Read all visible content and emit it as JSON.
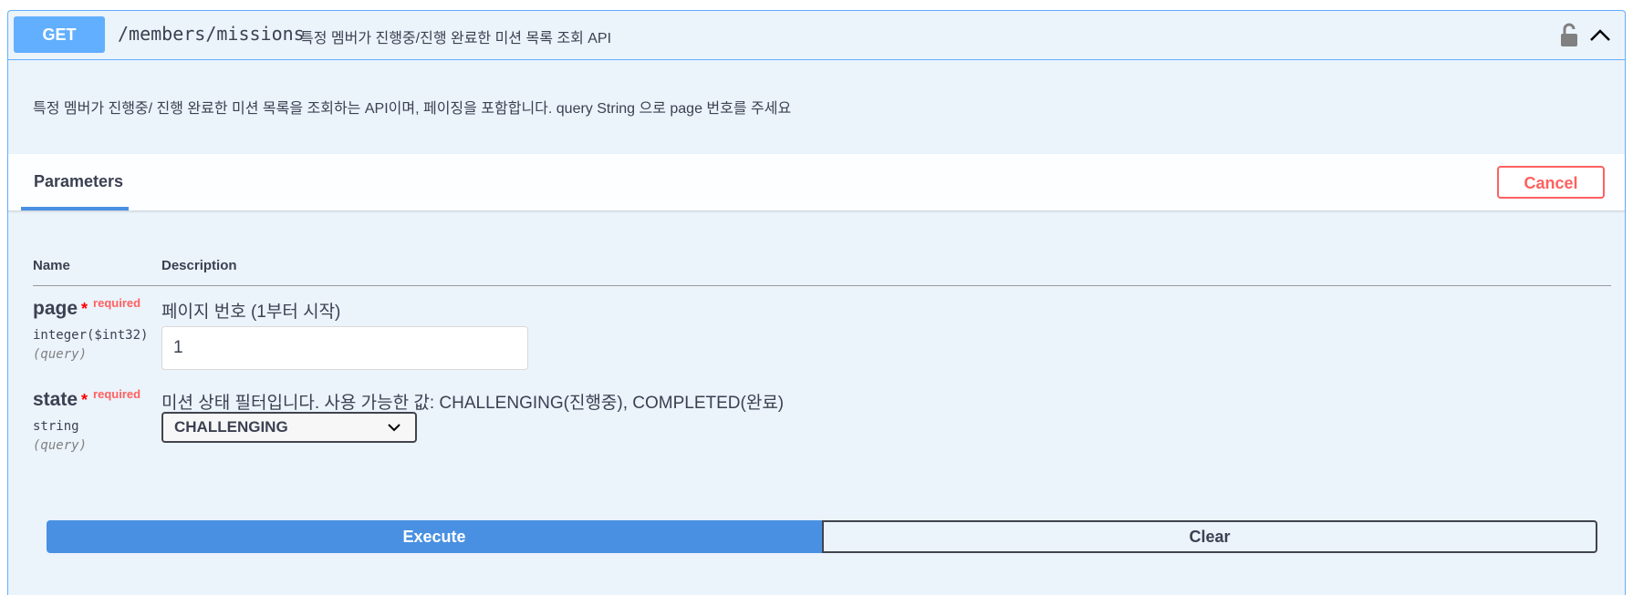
{
  "operation": {
    "method": "GET",
    "path": "/members/missions",
    "summary": "특정 멤버가 진행중/진행 완료한 미션 목록 조회 API",
    "description": "특정 멤버가 진행중/ 진행 완료한 미션 목록을 조회하는 API이며, 페이징을 포함합니다. query String 으로 page 번호를 주세요",
    "lock_icon": "unlocked-lock-icon",
    "collapse_icon": "chevron-up-icon"
  },
  "section": {
    "tab_label": "Parameters",
    "cancel_label": "Cancel"
  },
  "table": {
    "col_name": "Name",
    "col_description": "Description"
  },
  "params": [
    {
      "name": "page",
      "required_star": "*",
      "required_label": "required",
      "type": "integer($int32)",
      "in": "(query)",
      "description": "페이지 번호 (1부터 시작)",
      "value": "1"
    },
    {
      "name": "state",
      "required_star": "*",
      "required_label": "required",
      "type": "string",
      "in": "(query)",
      "description": "미션 상태 필터입니다. 사용 가능한 값: CHALLENGING(진행중), COMPLETED(완료)",
      "selected": "CHALLENGING"
    }
  ],
  "actions": {
    "execute_label": "Execute",
    "clear_label": "Clear"
  },
  "colors": {
    "get_blue": "#61affe",
    "execute_blue": "#4990e2",
    "cancel_red": "#ff6060",
    "panel_bg": "#ebf3fb"
  }
}
